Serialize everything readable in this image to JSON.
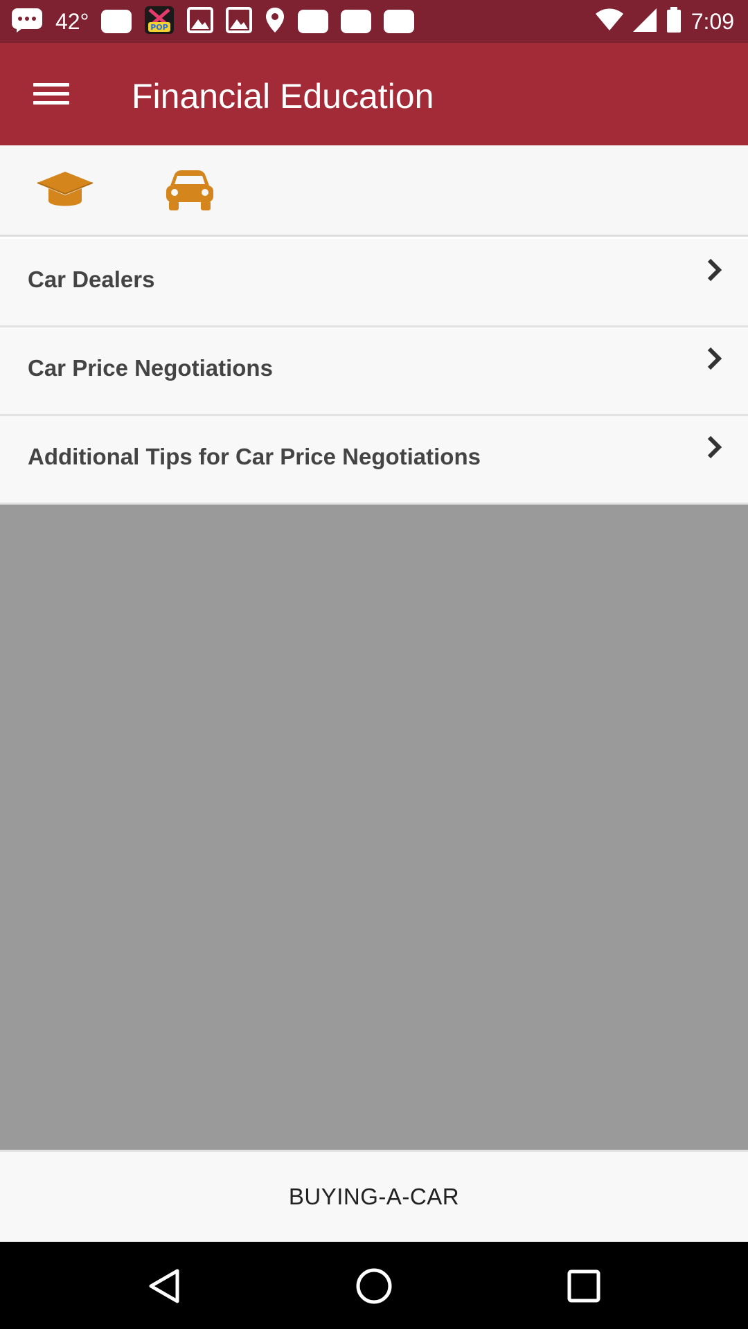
{
  "status_bar": {
    "temperature": "42°",
    "time": "7:09",
    "left_icons": [
      "messages-icon",
      "notification-square-icon",
      "pop-app-icon",
      "image-icon",
      "image-icon",
      "location-pin-icon",
      "notification-square-icon",
      "notification-square-icon",
      "notification-square-icon"
    ],
    "right_icons": [
      "wifi-icon",
      "signal-icon",
      "battery-icon"
    ]
  },
  "app_bar": {
    "title": "Financial Education",
    "menu_icon": "hamburger-menu-icon",
    "background_color": "#a32a37"
  },
  "tabs": [
    {
      "icon": "graduation-cap-icon",
      "color": "#d4861c"
    },
    {
      "icon": "car-icon",
      "color": "#d4861c"
    }
  ],
  "list": {
    "items": [
      {
        "label": "Car Dealers"
      },
      {
        "label": "Car Price Negotiations"
      },
      {
        "label": "Additional Tips for Car Price Negotiations"
      }
    ]
  },
  "footer": {
    "label": "BUYING-A-CAR"
  },
  "nav_bar": {
    "buttons": [
      "back-icon",
      "home-icon",
      "recents-icon"
    ]
  }
}
